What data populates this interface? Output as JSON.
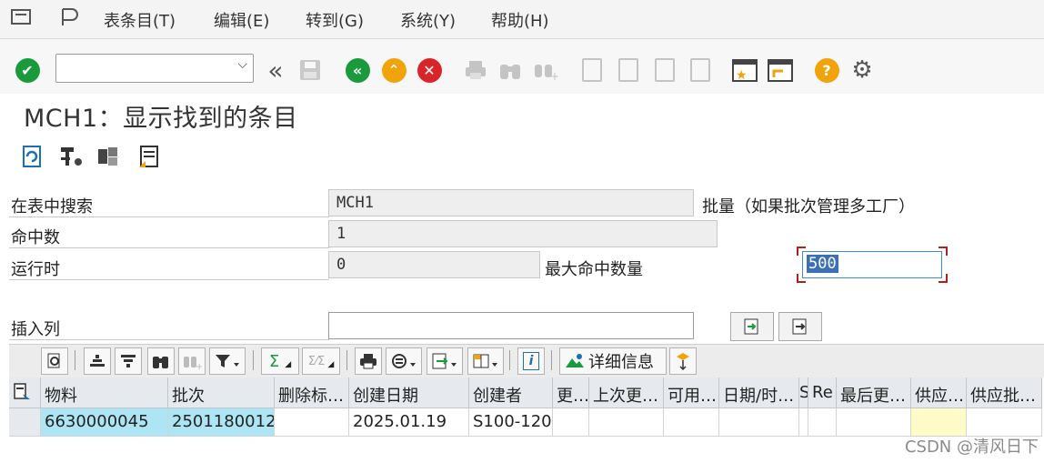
{
  "menu": {
    "items": [
      "表条目(T)",
      "编辑(E)",
      "转到(G)",
      "系统(Y)",
      "帮助(H)"
    ]
  },
  "toolbar": {
    "command_value": ""
  },
  "title": "MCH1：显示找到的条目",
  "form": {
    "search_label": "在表中搜索",
    "search_value": "MCH1",
    "search_desc": "批量（如果批次管理多工厂）",
    "hits_label": "命中数",
    "hits_value": "1",
    "runtime_label": "运行时",
    "runtime_value": "0",
    "maxhits_label": "最大命中数量",
    "maxhits_value": "500",
    "insert_label": "插入列"
  },
  "alv": {
    "details_label": "详细信息"
  },
  "grid": {
    "headers": [
      "物料",
      "批次",
      "删除标…",
      "创建日期",
      "创建者",
      "更…",
      "上次更…",
      "可用…",
      "日期/时…",
      "S",
      "Re",
      "最后更…",
      "供应…",
      "供应批…"
    ],
    "rows": [
      [
        "6630000045",
        "2501180012",
        "",
        "2025.01.19",
        "S100-120",
        "",
        "",
        "",
        "",
        "",
        "",
        "",
        "",
        ""
      ]
    ]
  },
  "watermark": "CSDN @清风日下",
  "colors": {
    "accent_green": "#1a9a3c",
    "accent_orange": "#f0a30a",
    "accent_red": "#d9252a",
    "key_cell": "#aee5f5",
    "highlight_cell": "#fffbc8"
  }
}
